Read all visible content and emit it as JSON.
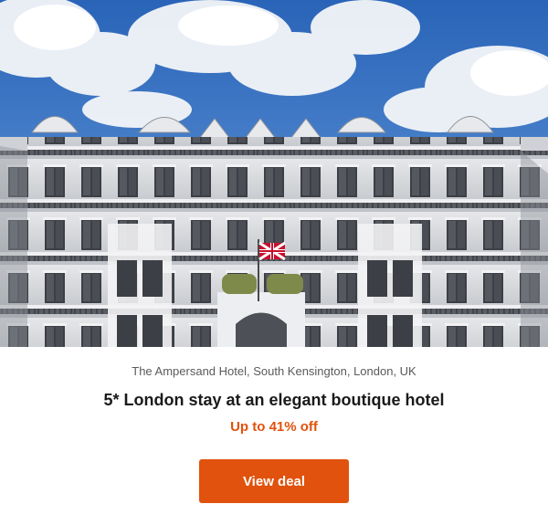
{
  "offer": {
    "location": "The Ampersand Hotel, South Kensington, London, UK",
    "title": "5* London stay at an elegant boutique hotel",
    "discount": "Up to 41% off",
    "cta_label": "View deal"
  },
  "colors": {
    "accent": "#e0520d",
    "sky": "#2f6fc2",
    "facade": "#d6d8dc"
  }
}
